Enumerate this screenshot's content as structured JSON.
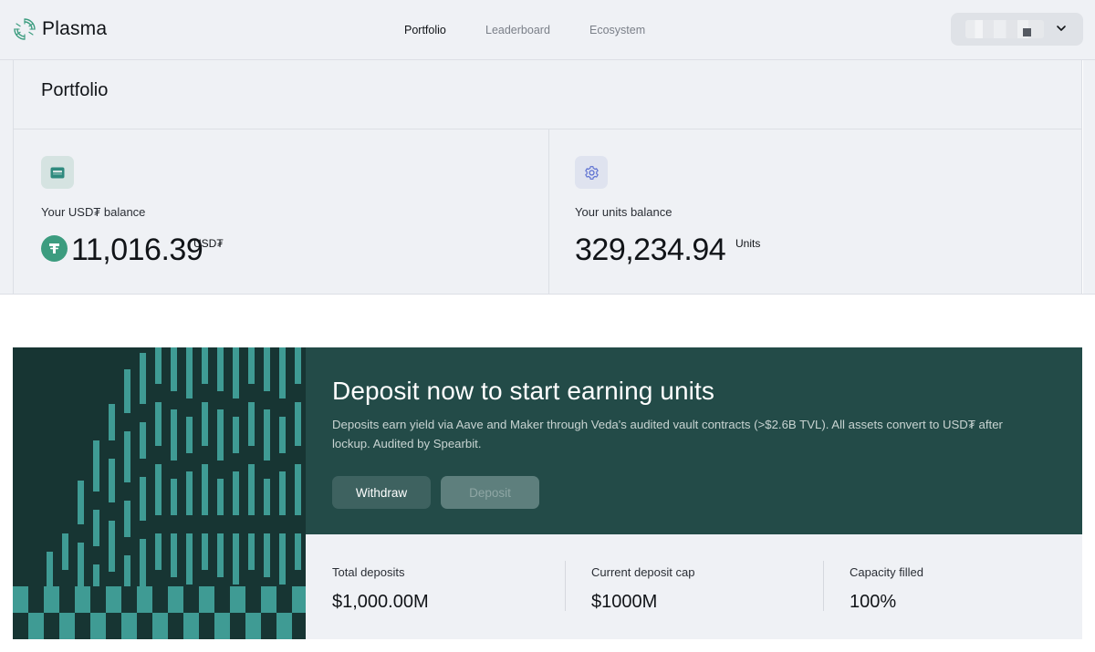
{
  "app": {
    "name": "Plasma"
  },
  "nav": {
    "items": [
      {
        "label": "Portfolio",
        "active": true
      },
      {
        "label": "Leaderboard",
        "active": false
      },
      {
        "label": "Ecosystem",
        "active": false
      }
    ]
  },
  "wallet": {
    "icon": "chevron-down-icon"
  },
  "portfolio": {
    "title": "Portfolio",
    "usdt_card": {
      "icon": "wallet-icon",
      "label": "Your USD₮ balance",
      "value": "11,016.39",
      "unit": "USD₮"
    },
    "units_card": {
      "icon": "gear-icon",
      "label": "Your units balance",
      "value": "329,234.94",
      "unit": "Units"
    }
  },
  "deposit_banner": {
    "title": "Deposit now to start earning units",
    "description": "Deposits earn yield via Aave and Maker through Veda's audited vault contracts (>$2.6B TVL). All assets convert to USD₮ after lockup. Audited by Spearbit.",
    "withdraw_label": "Withdraw",
    "deposit_label": "Deposit",
    "deposit_disabled": true
  },
  "stats": {
    "total_deposits": {
      "label": "Total deposits",
      "value": "$1,000.00M"
    },
    "deposit_cap": {
      "label": "Current deposit cap",
      "value": "$1000M"
    },
    "capacity": {
      "label": "Capacity filled",
      "value": "100%"
    }
  },
  "colors": {
    "accent": "#3c9c7f",
    "banner_dark": "#173533",
    "banner_teal": "#234b48",
    "bar_teal": "#3f9b94",
    "panel_bg": "#eff1f5"
  }
}
